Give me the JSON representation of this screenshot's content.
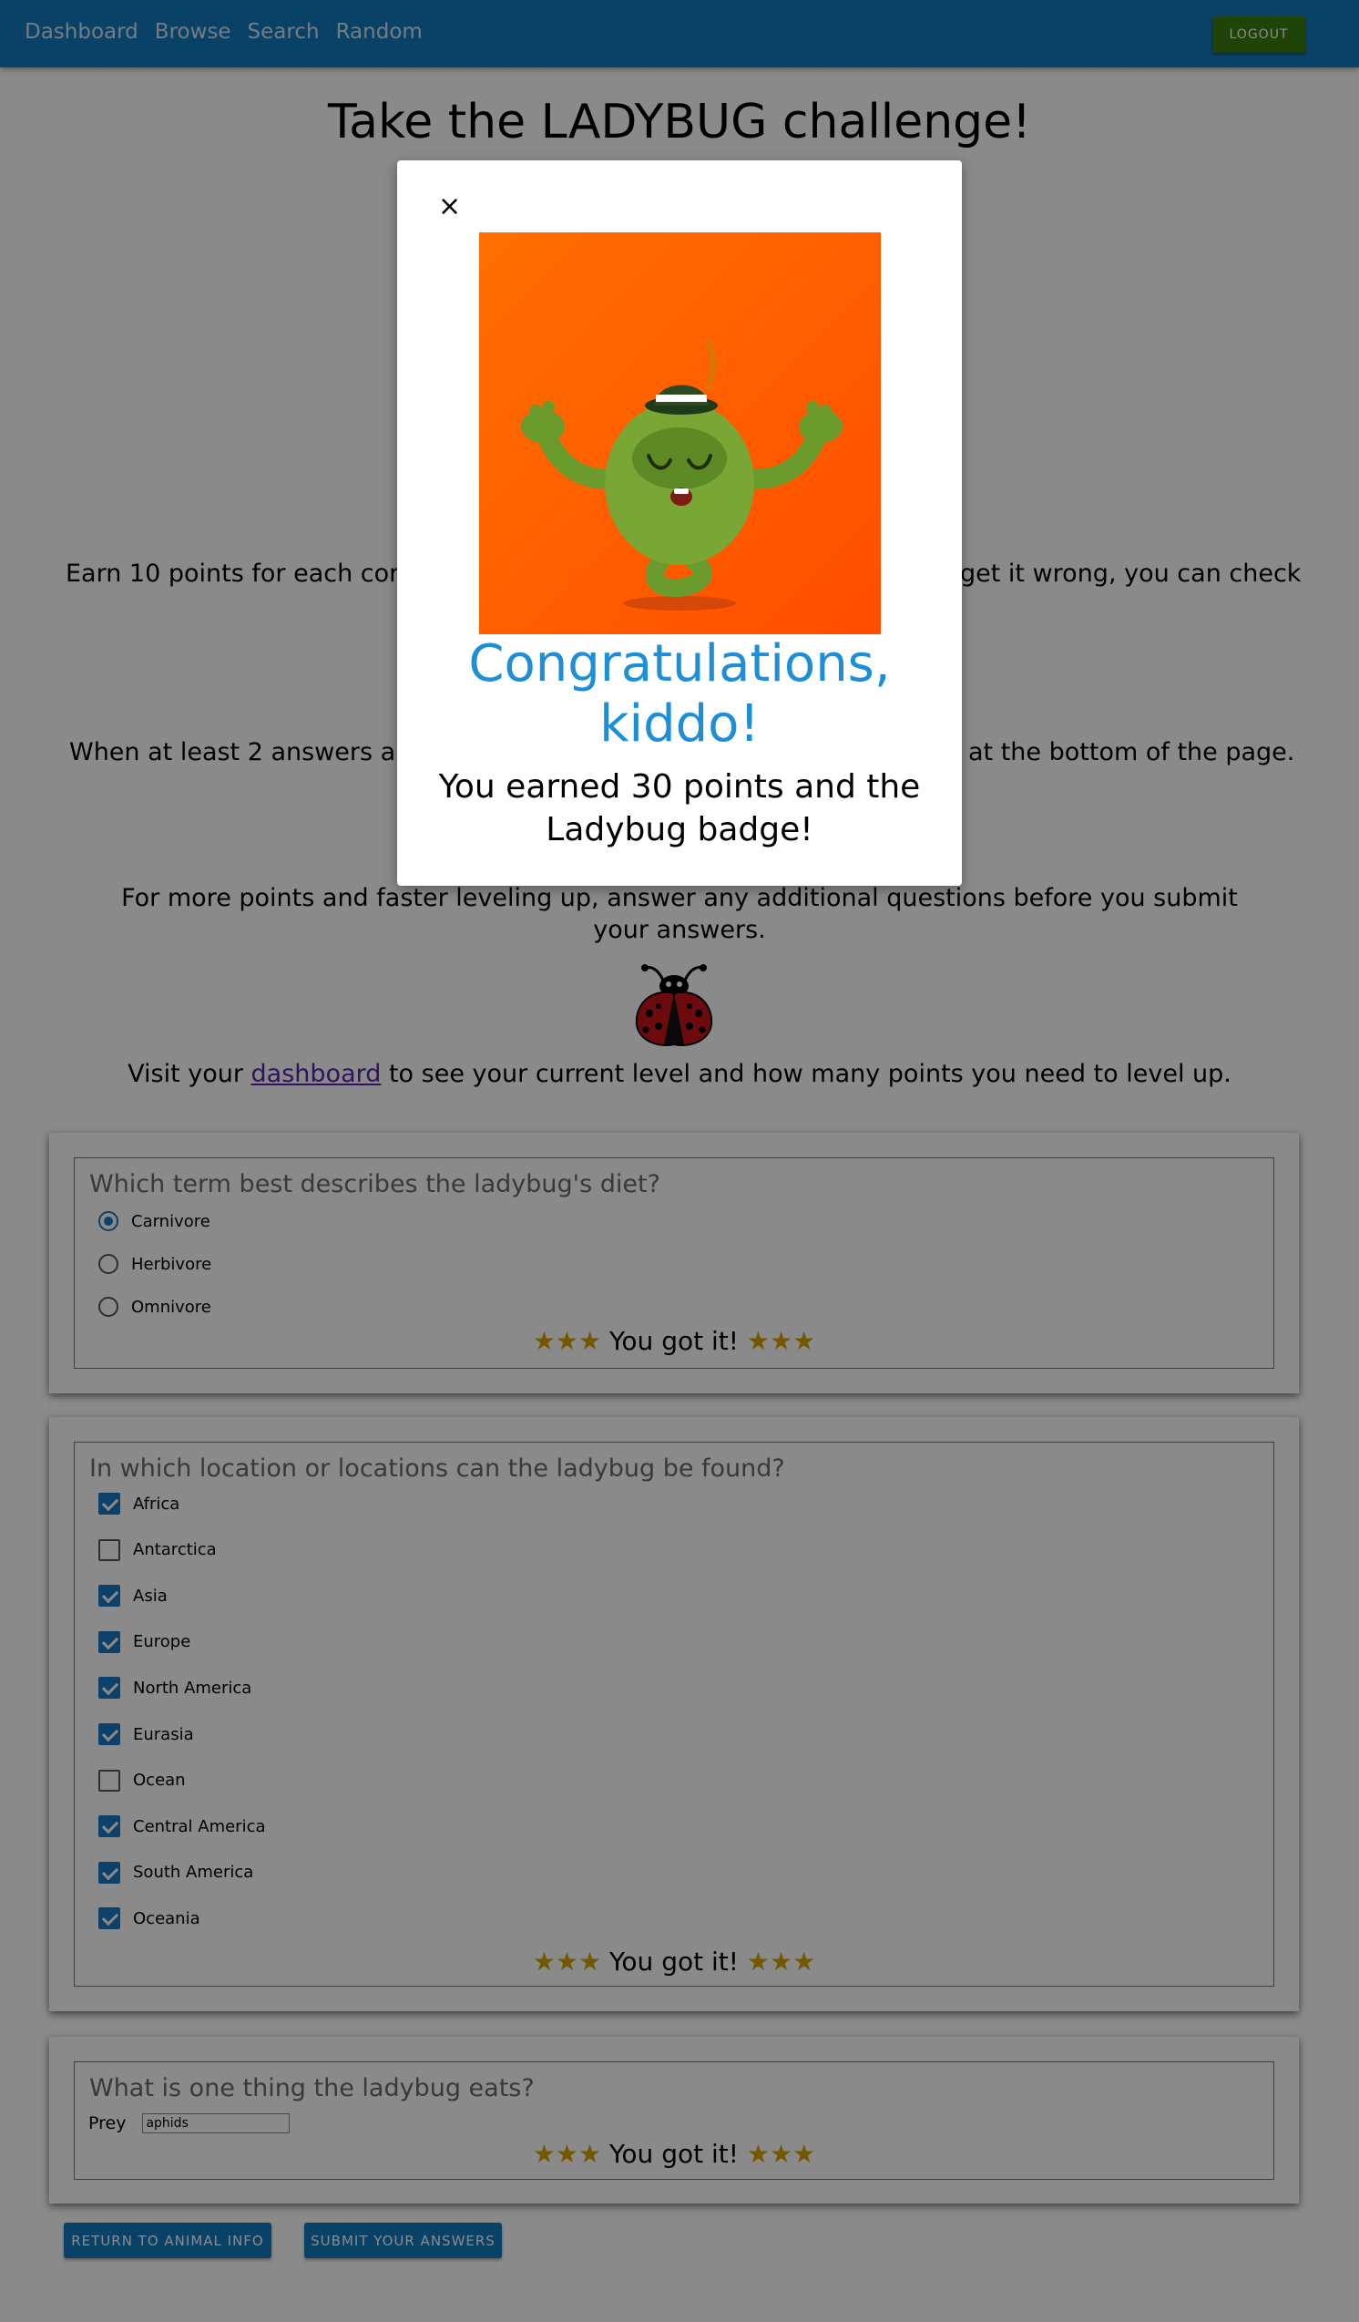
{
  "nav": {
    "links": [
      "Dashboard",
      "Browse",
      "Search",
      "Random"
    ],
    "logout_label": "LOGOUT"
  },
  "page_title": "Take the LADYBUG challenge!",
  "intro": {
    "p1_left": "Earn 10 points for each corre",
    "p1_right": "get it wrong, you can check",
    "p2_left": "When at least 2 answers are",
    "p2_right": "at the bottom of the page.",
    "p3": "For more points and faster leveling up, answer any additional questions before you submit your answers."
  },
  "visit": {
    "before": "Visit your ",
    "link": "dashboard",
    "after": " to see your current level and how many points you need to level up."
  },
  "q1": {
    "title": "Which term best describes the ladybug's diet?",
    "options": [
      {
        "label": "Carnivore",
        "selected": true
      },
      {
        "label": "Herbivore",
        "selected": false
      },
      {
        "label": "Omnivore",
        "selected": false
      }
    ],
    "result": "You got it!"
  },
  "q2": {
    "title": "In which location or locations can the ladybug be found?",
    "options": [
      {
        "label": "Africa",
        "checked": true
      },
      {
        "label": "Antarctica",
        "checked": false
      },
      {
        "label": "Asia",
        "checked": true
      },
      {
        "label": "Europe",
        "checked": true
      },
      {
        "label": "North America",
        "checked": true
      },
      {
        "label": "Eurasia",
        "checked": true
      },
      {
        "label": "Ocean",
        "checked": false
      },
      {
        "label": "Central America",
        "checked": true
      },
      {
        "label": "South America",
        "checked": true
      },
      {
        "label": "Oceania",
        "checked": true
      }
    ],
    "result": "You got it!"
  },
  "q3": {
    "title": "What is one thing the ladybug eats?",
    "field_label": "Prey",
    "field_value": "aphids",
    "result": "You got it!"
  },
  "buttons": {
    "return_label": "RETURN TO ANIMAL INFO",
    "submit_label": "SUBMIT YOUR ANSWERS"
  },
  "modal": {
    "close_label": "×",
    "title": "Congratulations, kiddo!",
    "message": "You earned 30 points and the Ladybug badge!"
  },
  "colors": {
    "nav": "#1479bd",
    "logout": "#3b7d0e",
    "accent": "#1e8fd6",
    "modal_bg_orange": "#ff5a00"
  }
}
